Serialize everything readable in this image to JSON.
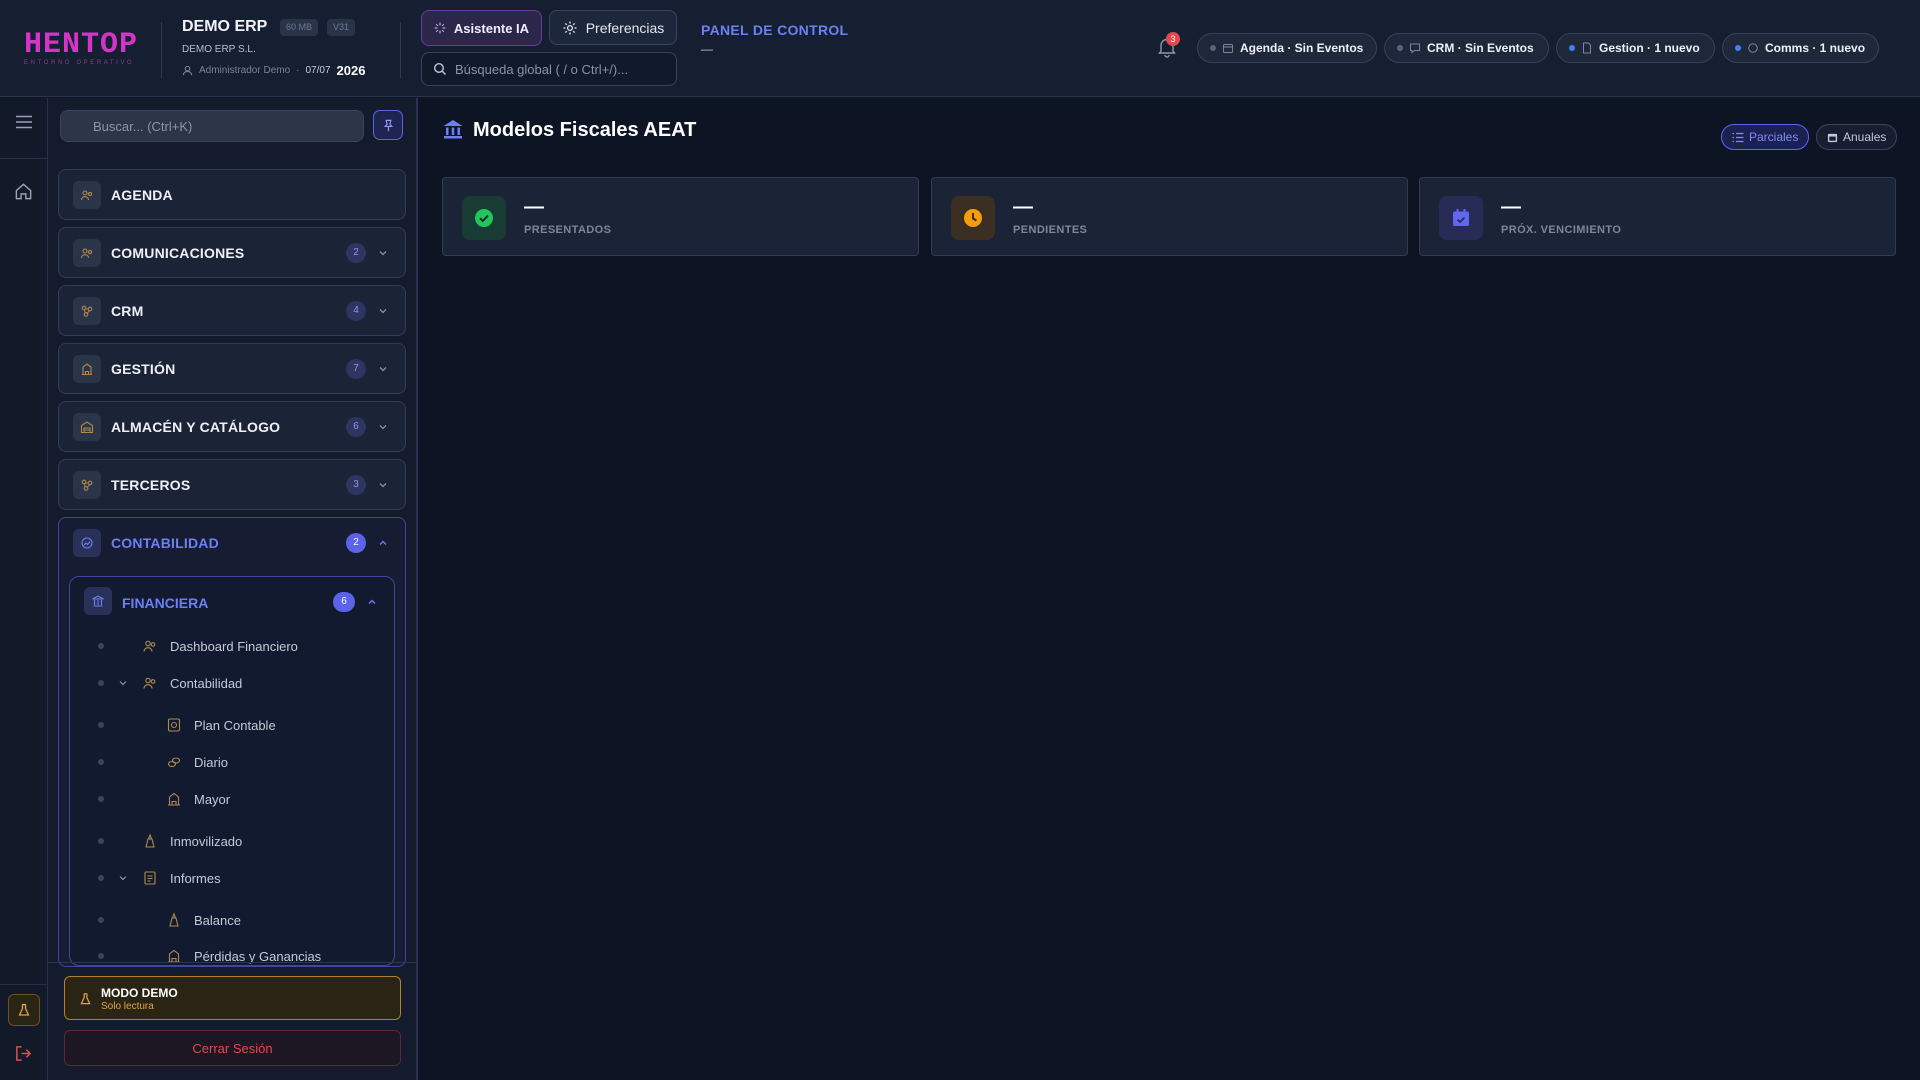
{
  "header": {
    "logo_text": "HENTOP",
    "logo_sub": "ENTORNO OPERATIVO",
    "company_name": "DEMO ERP",
    "storage_tag": "60 MB",
    "version_tag": "V31",
    "company_legal": "DEMO ERP S.L.",
    "user_name": "Administrador Demo",
    "date_short": "07/07",
    "year": "2026",
    "ai_button": "Asistente IA",
    "prefs_button": "Preferencias",
    "search_placeholder": "Búsqueda global ( / o Ctrl+/)...",
    "panel_title": "PANEL DE CONTROL",
    "panel_sub": "—",
    "notification_count": "3",
    "status_chips": [
      {
        "label": "Agenda · Sin Eventos",
        "dot": "#5a6478",
        "icon": "calendar-icon"
      },
      {
        "label": "CRM · Sin Eventos",
        "dot": "#5a6478",
        "icon": "message-icon"
      },
      {
        "label": "Gestion · 1 nuevo",
        "dot": "#3b82f6",
        "icon": "document-icon"
      },
      {
        "label": "Comms · 1 nuevo",
        "dot": "#3b82f6",
        "icon": "chat-icon"
      }
    ]
  },
  "sidebar": {
    "search_placeholder": "Buscar... (Ctrl+K)",
    "sections": [
      {
        "label": "AGENDA",
        "count": ""
      },
      {
        "label": "COMUNICACIONES",
        "count": "2"
      },
      {
        "label": "CRM",
        "count": "4"
      },
      {
        "label": "GESTIÓN",
        "count": "7"
      },
      {
        "label": "ALMACÉN Y CATÁLOGO",
        "count": "6"
      },
      {
        "label": "TERCEROS",
        "count": "3"
      },
      {
        "label": "CONTABILIDAD",
        "count": "2"
      }
    ],
    "subsection": {
      "label": "FINANCIERA",
      "count": "6"
    },
    "nav_items": [
      {
        "label": "Dashboard Financiero"
      },
      {
        "label": "Contabilidad"
      },
      {
        "label": "Plan Contable"
      },
      {
        "label": "Diario"
      },
      {
        "label": "Mayor"
      },
      {
        "label": "Inmovilizado"
      },
      {
        "label": "Informes"
      },
      {
        "label": "Balance"
      },
      {
        "label": "Pérdidas y Ganancias"
      }
    ],
    "demo_title": "MODO DEMO",
    "demo_sub": "Solo lectura",
    "logout": "Cerrar Sesión"
  },
  "main": {
    "title": "Modelos Fiscales AEAT",
    "toggle_partial": "Parciales",
    "toggle_annual": "Anuales",
    "kpis": [
      {
        "value": "—",
        "label": "PRESENTADOS",
        "color": "#22c55e"
      },
      {
        "value": "—",
        "label": "PENDIENTES",
        "color": "#f59e0b"
      },
      {
        "value": "—",
        "label": "PRÓX. VENCIMIENTO",
        "color": "#6366f1"
      }
    ]
  },
  "colors": {
    "accent": "#6d7ff5",
    "brand": "#d435c6",
    "background": "#0d1424",
    "danger": "#e5484d",
    "warning": "#e0a443"
  }
}
